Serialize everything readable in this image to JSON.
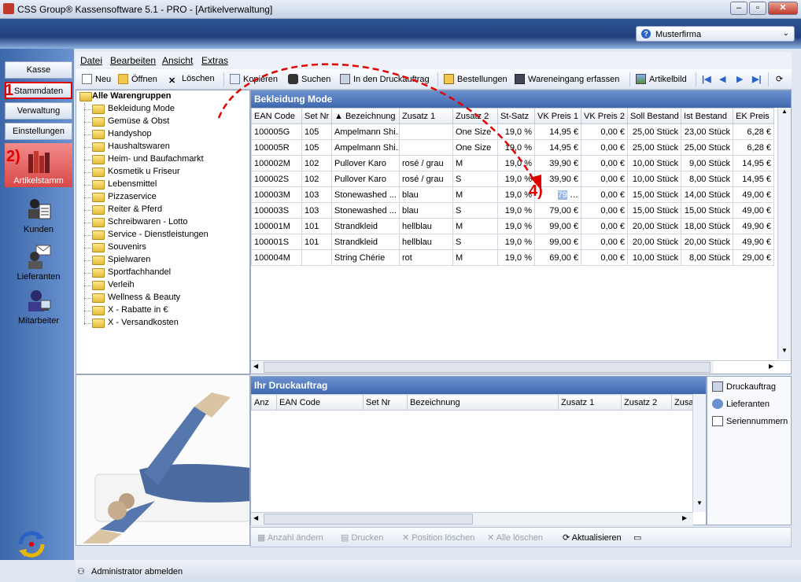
{
  "window": {
    "title": "CSS Group® Kassensoftware 5.1 - PRO - [Artikelverwaltung]",
    "buttons": [
      "–",
      "▫",
      "✕"
    ]
  },
  "company": {
    "label": "Musterfirma"
  },
  "leftnav": {
    "buttons": [
      "Kasse",
      "Stammdaten",
      "Verwaltung",
      "Einstellungen"
    ],
    "big": [
      "Artikelstamm",
      "Kunden",
      "Lieferanten",
      "Mitarbeiter"
    ]
  },
  "annotations": [
    "1",
    "2)",
    "3)",
    "4)"
  ],
  "menu": [
    "Datei",
    "Bearbeiten",
    "Ansicht",
    "Extras"
  ],
  "toolbar": [
    "Neu",
    "Öffnen",
    "Löschen",
    "Kopieren",
    "Suchen",
    "In den Druckauftrag",
    "Bestellungen",
    "Wareneingang erfassen",
    "Artikelbild"
  ],
  "tree": {
    "root": "Alle Warengruppen",
    "items": [
      "Bekleidung Mode",
      "Gemüse & Obst",
      "Handyshop",
      "Haushaltswaren",
      "Heim- und Baufachmarkt",
      "Kosmetik u Friseur",
      "Lebensmittel",
      "Pizzaservice",
      "Reiter & Pferd",
      "Schreibwaren - Lotto",
      "Service - Dienstleistungen",
      "Souvenirs",
      "Spielwaren",
      "Sportfachhandel",
      "Verleih",
      "Wellness & Beauty",
      "X - Rabatte in €",
      "X - Versandkosten"
    ]
  },
  "grid": {
    "title": "Bekleidung Mode",
    "columns": [
      "EAN Code",
      "Set Nr",
      "▲ Bezeichnung",
      "Zusatz 1",
      "Zusatz 2",
      "St-Satz",
      "VK Preis 1",
      "VK Preis 2",
      "Soll Bestand",
      "Ist Bestand",
      "EK Preis"
    ],
    "rows": [
      [
        "100005G",
        "105",
        "Ampelmann Shi...",
        "",
        "One Size",
        "19,0 %",
        "14,95 €",
        "0,00 €",
        "25,00 Stück",
        "23,00 Stück",
        "6,28 €"
      ],
      [
        "100005R",
        "105",
        "Ampelmann Shi...",
        "",
        "One Size",
        "19,0 %",
        "14,95 €",
        "0,00 €",
        "25,00 Stück",
        "25,00 Stück",
        "6,28 €"
      ],
      [
        "100002M",
        "102",
        "Pullover Karo",
        "rosé / grau",
        "M",
        "19,0 %",
        "39,90 €",
        "0,00 €",
        "10,00 Stück",
        "9,00 Stück",
        "14,95 €"
      ],
      [
        "100002S",
        "102",
        "Pullover Karo",
        "rosé / grau",
        "S",
        "19,0 %",
        "39,90 €",
        "0,00 €",
        "10,00 Stück",
        "8,00 Stück",
        "14,95 €"
      ],
      [
        "100003M",
        "103",
        "Stonewashed ...",
        "blau",
        "M",
        "19,0 %",
        "79",
        "0,00 €",
        "15,00 Stück",
        "14,00 Stück",
        "49,00 €"
      ],
      [
        "100003S",
        "103",
        "Stonewashed ...",
        "blau",
        "S",
        "19,0 %",
        "79,00 €",
        "0,00 €",
        "15,00 Stück",
        "15,00 Stück",
        "49,00 €"
      ],
      [
        "100001M",
        "101",
        "Strandkleid",
        "hellblau",
        "M",
        "19,0 %",
        "99,00 €",
        "0,00 €",
        "20,00 Stück",
        "18,00 Stück",
        "49,90 €"
      ],
      [
        "100001S",
        "101",
        "Strandkleid",
        "hellblau",
        "S",
        "19,0 %",
        "99,00 €",
        "0,00 €",
        "20,00 Stück",
        "20,00 Stück",
        "49,90 €"
      ],
      [
        "100004M",
        "",
        "String Chérie",
        "rot",
        "M",
        "19,0 %",
        "69,00 €",
        "0,00 €",
        "10,00 Stück",
        "8,00 Stück",
        "29,00 €"
      ]
    ]
  },
  "print": {
    "title": "Ihr Druckauftrag",
    "columns": [
      "Anz",
      "EAN Code",
      "Set Nr",
      "Bezeichnung",
      "Zusatz 1",
      "Zusatz 2",
      "Zusa"
    ],
    "side": [
      "Druckauftrag",
      "Lieferanten",
      "Seriennummern"
    ],
    "buttons": [
      "Anzahl ändern",
      "Drucken",
      "Position löschen",
      "Alle löschen",
      "Aktualisieren"
    ]
  },
  "status": {
    "text": "Administrator abmelden"
  },
  "colors": {
    "accent": "#3e67ad",
    "marker": "#e00000",
    "highlight": "#e05050"
  }
}
